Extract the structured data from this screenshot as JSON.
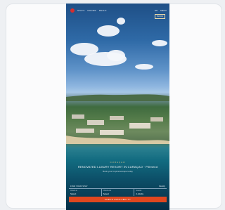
{
  "nav": {
    "links": [
      "STAYS",
      "ROOMS",
      "DEALS"
    ],
    "right_links": [
      "EN",
      "MENU"
    ],
    "chip": "BOOK"
  },
  "hero": {
    "eyebrow": "CURAÇAO",
    "headline": "RENOVATED LUXURY RESORT IN CURAÇAO · Pillmend",
    "subline": "Book your tropical escape today"
  },
  "booking": {
    "title": "FIND YOUR STAY",
    "aux": "Modify",
    "fields": [
      {
        "label": "Check-in",
        "value": "Select"
      },
      {
        "label": "Check-out",
        "value": "Select"
      },
      {
        "label": "Guests",
        "value": "2 Adults"
      }
    ],
    "cta": "CHECK AVAILABILITY"
  },
  "colors": {
    "accent": "#e0471f",
    "brand": "#d62e2e"
  }
}
